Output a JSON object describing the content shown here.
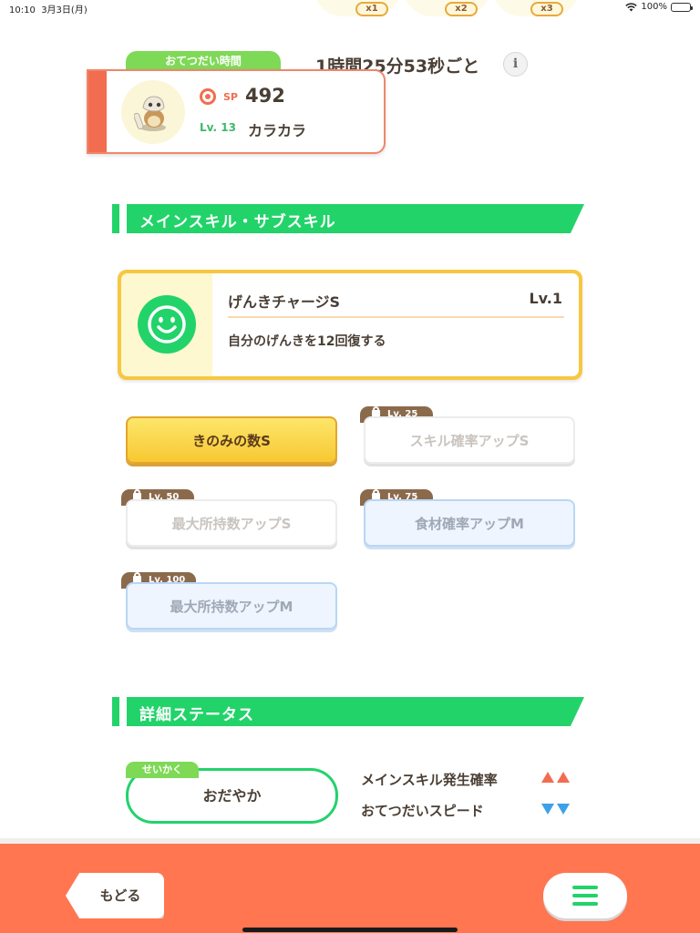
{
  "status_bar": {
    "time": "10:10",
    "date": "3月3日(月)",
    "battery": "100%"
  },
  "speed_buttons": [
    "x1",
    "x2",
    "x3"
  ],
  "helper": {
    "label": "おてつだい時間",
    "time": "1時間25分53秒ごと",
    "info_icon": "i"
  },
  "pokemon": {
    "sp_label": "SP",
    "sp_value": "492",
    "level": "Lv. 13",
    "name": "カラカラ"
  },
  "sections": {
    "skills_title": "メインスキル・サブスキル",
    "status_title": "詳細ステータス"
  },
  "main_skill": {
    "name": "げんきチャージS",
    "level": "Lv.1",
    "description": "自分のげんきを12回復する"
  },
  "sub_skills": [
    {
      "label": "きのみの数S",
      "unlock": "",
      "state": "active"
    },
    {
      "label": "スキル確率アップS",
      "unlock": "Lv. 25",
      "state": "locked"
    },
    {
      "label": "最大所持数アップS",
      "unlock": "Lv. 50",
      "state": "locked"
    },
    {
      "label": "食材確率アップM",
      "unlock": "Lv. 75",
      "state": "locked-blue"
    },
    {
      "label": "最大所持数アップM",
      "unlock": "Lv. 100",
      "state": "locked-blue"
    }
  ],
  "nature": {
    "label": "せいかく",
    "value": "おだやか",
    "up_stat": "メインスキル発生確率",
    "down_stat": "おてつだいスピード"
  },
  "bottom_bar": {
    "back_label": "もどる"
  },
  "colors": {
    "accent_green": "#22d36a",
    "accent_orange": "#ff7651",
    "up_arrow": "#f26d4f",
    "down_arrow": "#3ea0e8"
  }
}
